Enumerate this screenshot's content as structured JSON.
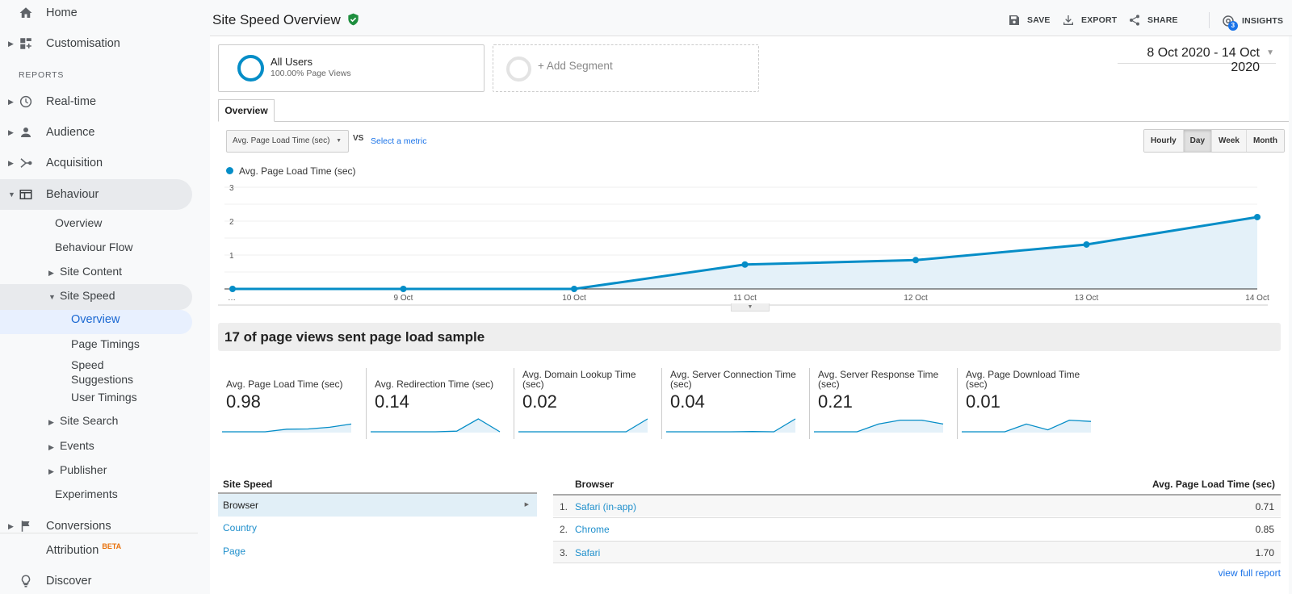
{
  "sidebar": {
    "items": [
      {
        "label": "Home",
        "icon": "home-icon"
      },
      {
        "label": "Customisation",
        "icon": "dashboard-add-icon"
      },
      {
        "label": "Real-time",
        "icon": "clock-icon"
      },
      {
        "label": "Audience",
        "icon": "person-icon"
      },
      {
        "label": "Acquisition",
        "icon": "acquisition-icon"
      },
      {
        "label": "Behaviour",
        "icon": "behaviour-icon"
      },
      {
        "label": "Conversions",
        "icon": "flag-icon"
      },
      {
        "label": "Attribution",
        "icon": ""
      },
      {
        "label": "Discover",
        "icon": "lightbulb-icon"
      }
    ],
    "reports_heading": "REPORTS",
    "attribution_badge": "BETA",
    "behaviour_sub": [
      {
        "label": "Overview"
      },
      {
        "label": "Behaviour Flow"
      },
      {
        "label": "Site Content"
      },
      {
        "label": "Site Speed"
      },
      {
        "label": "Site Search"
      },
      {
        "label": "Events"
      },
      {
        "label": "Publisher"
      },
      {
        "label": "Experiments"
      }
    ],
    "site_speed_sub": [
      {
        "label": "Overview"
      },
      {
        "label": "Page Timings"
      },
      {
        "label": "Speed Suggestions"
      },
      {
        "label": "User Timings"
      }
    ]
  },
  "header": {
    "title": "Site Speed Overview",
    "actions": {
      "save": "SAVE",
      "export": "EXPORT",
      "share": "SHARE",
      "insights": "INSIGHTS",
      "insights_badge": "3"
    }
  },
  "segments": {
    "active": {
      "name": "All Users",
      "detail": "100.00% Page Views"
    },
    "add": "+ Add Segment"
  },
  "date_range": "8 Oct 2020 - 14 Oct 2020",
  "tabs": [
    {
      "label": "Overview"
    }
  ],
  "metric_select": {
    "value": "Avg. Page Load Time (sec)",
    "vs": "VS",
    "select_metric": "Select a metric"
  },
  "granularity": {
    "options": [
      "Hourly",
      "Day",
      "Week",
      "Month"
    ],
    "selected": "Day"
  },
  "chart_data": {
    "type": "area",
    "title": "",
    "legend": [
      "Avg. Page Load Time (sec)"
    ],
    "legend_position": "top-left",
    "x": [
      "…",
      "9 Oct",
      "10 Oct",
      "11 Oct",
      "12 Oct",
      "13 Oct",
      "14 Oct"
    ],
    "series": [
      {
        "name": "Avg. Page Load Time (sec)",
        "values": [
          0,
          0,
          0,
          0.72,
          0.85,
          1.31,
          2.12
        ]
      }
    ],
    "yticks": [
      1,
      2,
      3
    ],
    "ylim": [
      0,
      3
    ],
    "grid": true,
    "color": "#058dc7"
  },
  "sample_banner": "17 of page views sent page load sample",
  "scorecards": [
    {
      "label": "Avg. Page Load Time (sec)",
      "value": "0.98",
      "spark": [
        0,
        0,
        0,
        0.2,
        0.22,
        0.35,
        0.6
      ]
    },
    {
      "label": "Avg. Redirection Time (sec)",
      "value": "0.14",
      "spark": [
        0,
        0,
        0,
        0,
        0.05,
        1,
        0
      ]
    },
    {
      "label": "Avg. Domain Lookup Time (sec)",
      "value": "0.02",
      "spark": [
        0,
        0,
        0,
        0,
        0,
        0,
        1
      ]
    },
    {
      "label": "Avg. Server Connection Time (sec)",
      "value": "0.04",
      "spark": [
        0,
        0,
        0,
        0,
        0.02,
        0,
        1
      ]
    },
    {
      "label": "Avg. Server Response Time (sec)",
      "value": "0.21",
      "spark": [
        0,
        0,
        0,
        0.6,
        0.9,
        0.9,
        0.6
      ]
    },
    {
      "label": "Avg. Page Download Time (sec)",
      "value": "0.01",
      "spark": [
        0,
        0,
        0,
        0.6,
        0.15,
        0.9,
        0.8
      ]
    }
  ],
  "dimensions": {
    "heading": "Site Speed",
    "items": [
      {
        "label": "Browser",
        "selected": true
      },
      {
        "label": "Country"
      },
      {
        "label": "Page"
      }
    ]
  },
  "table": {
    "headers": [
      "Browser",
      "Avg. Page Load Time (sec)"
    ],
    "rows": [
      {
        "rank": "1.",
        "name": "Safari (in-app)",
        "value": "0.71"
      },
      {
        "rank": "2.",
        "name": "Chrome",
        "value": "0.85"
      },
      {
        "rank": "3.",
        "name": "Safari",
        "value": "1.70"
      }
    ],
    "view_full": "view full report"
  }
}
